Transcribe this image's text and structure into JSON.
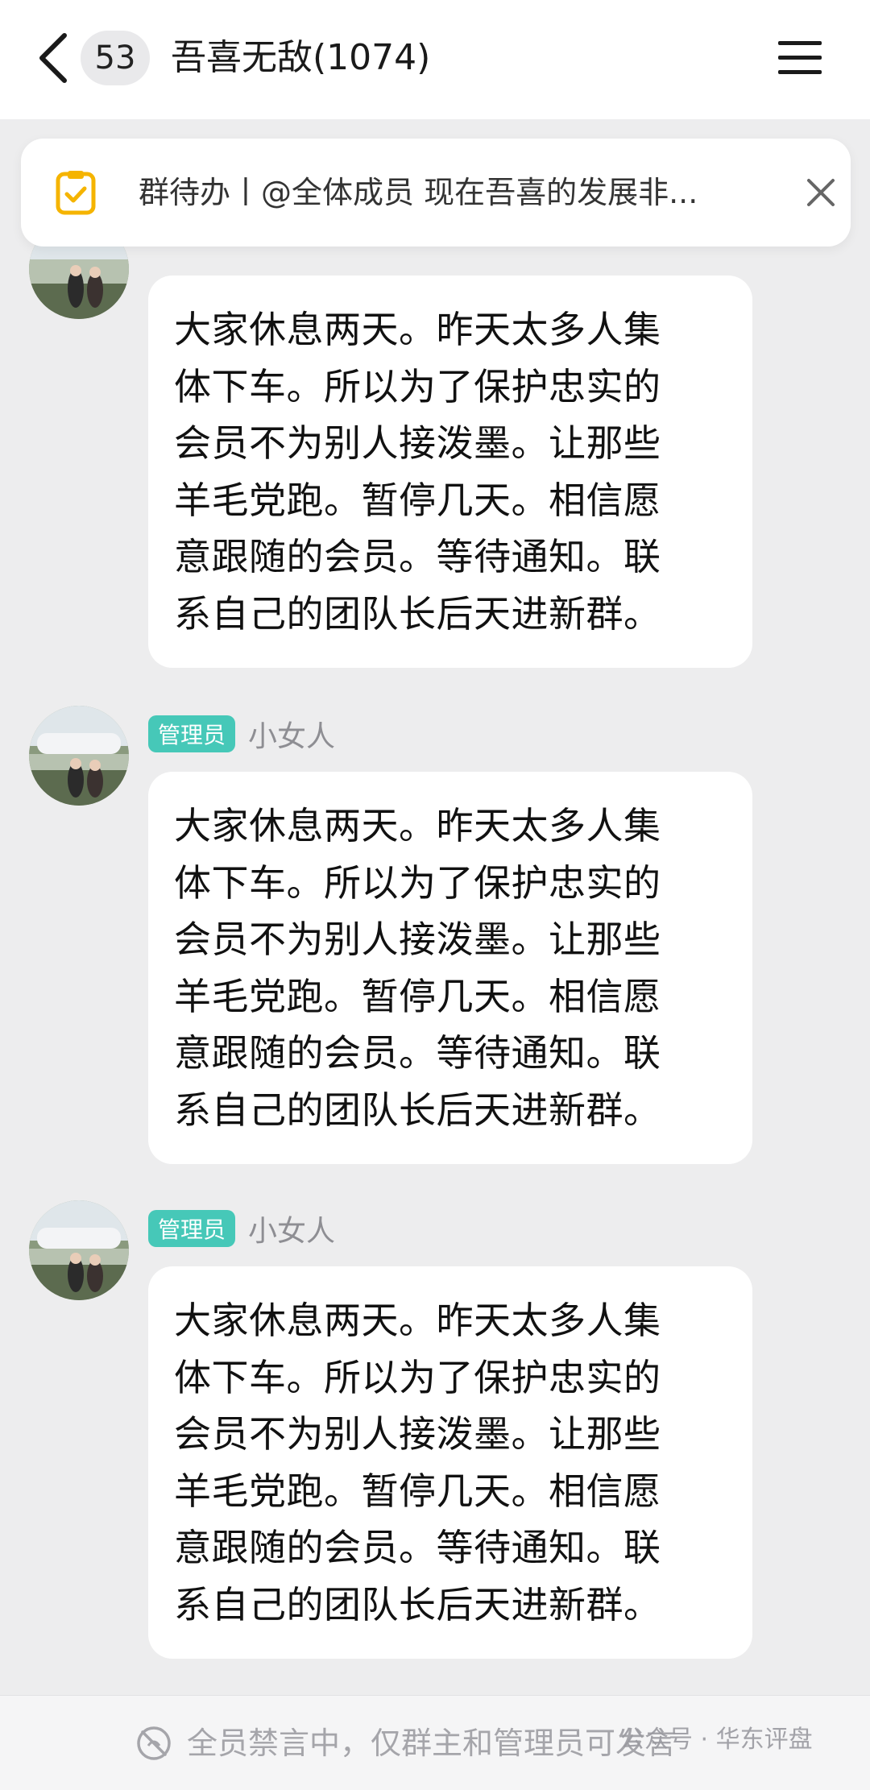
{
  "header": {
    "back_icon": "chevron-left-icon",
    "unread_count": "53",
    "title": "吾喜无敌(1074)",
    "menu_icon": "hamburger-menu-icon"
  },
  "todo_banner": {
    "icon": "todo-clipboard-icon",
    "text": "群待办丨@全体成员 现在吾喜的发展非...",
    "close_icon": "close-icon",
    "accent_color": "#f5b400"
  },
  "messages": [
    {
      "role": "",
      "sender": "",
      "lines": [
        "大家休息两天。昨天太多人集",
        "体下车。所以为了保护忠实的",
        "会员不为别人接泼墨。让那些",
        "羊毛党跑。暂停几天。相信愿",
        "意跟随的会员。等待通知。联",
        "系自己的团队长后天进新群。"
      ]
    },
    {
      "role": "管理员",
      "sender": "小女人",
      "lines": [
        "大家休息两天。昨天太多人集",
        "体下车。所以为了保护忠实的",
        "会员不为别人接泼墨。让那些",
        "羊毛党跑。暂停几天。相信愿",
        "意跟随的会员。等待通知。联",
        "系自己的团队长后天进新群。"
      ]
    },
    {
      "role": "管理员",
      "sender": "小女人",
      "lines": [
        "大家休息两天。昨天太多人集",
        "体下车。所以为了保护忠实的",
        "会员不为别人接泼墨。让那些",
        "羊毛党跑。暂停几天。相信愿",
        "意跟随的会员。等待通知。联",
        "系自己的团队长后天进新群。"
      ]
    }
  ],
  "footer": {
    "mute_icon": "muted-icon",
    "mute_text": "全员禁言中，仅群主和管理员可发言",
    "watermark": "公众号 · 华东评盘"
  },
  "colors": {
    "role_badge": "#46c8b8",
    "background": "#ededee"
  }
}
